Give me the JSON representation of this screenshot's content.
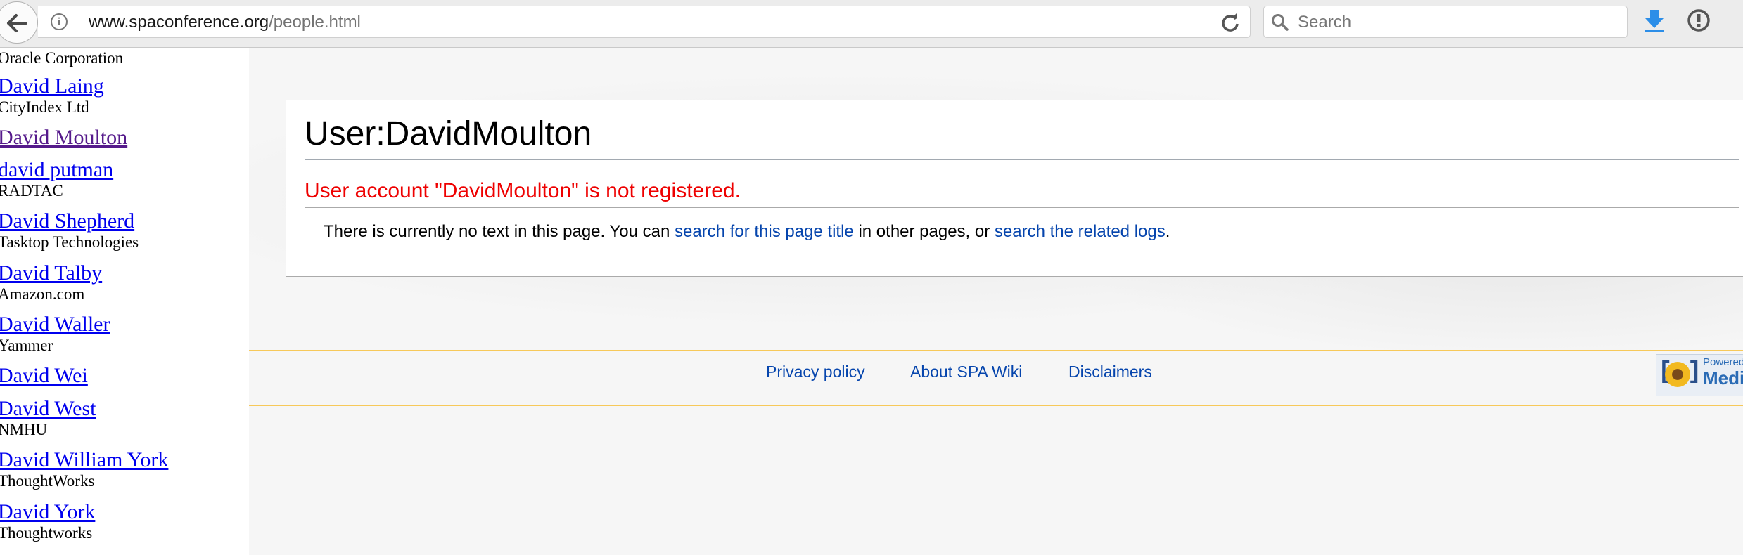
{
  "browser": {
    "url_host": "www.spaconference.org",
    "url_path": "/people.html",
    "search_placeholder": "Search"
  },
  "sidebar": {
    "people": [
      {
        "name": "",
        "org": "Oracle Corporation"
      },
      {
        "name": "David Laing",
        "org": "CityIndex Ltd"
      },
      {
        "name": "David Moulton",
        "org": ""
      },
      {
        "name": "david putman",
        "org": "RADTAC"
      },
      {
        "name": "David Shepherd",
        "org": "Tasktop Technologies"
      },
      {
        "name": "David Talby",
        "org": "Amazon.com"
      },
      {
        "name": "David Waller",
        "org": "Yammer"
      },
      {
        "name": "David Wei",
        "org": ""
      },
      {
        "name": "David West",
        "org": "NMHU"
      },
      {
        "name": "David William York",
        "org": "ThoughtWorks"
      },
      {
        "name": "David York",
        "org": "Thoughtworks"
      }
    ]
  },
  "page": {
    "title": "User:DavidMoulton",
    "error": "User account \"DavidMoulton\" is not registered.",
    "notice_prefix": "There is currently no text in this page. You can ",
    "notice_link1": "search for this page title",
    "notice_middle": " in other pages, or ",
    "notice_link2": "search the related logs",
    "notice_suffix": "."
  },
  "footer": {
    "links": [
      "Privacy policy",
      "About SPA Wiki",
      "Disclaimers"
    ],
    "badge_small": "Powered by",
    "badge_big": "MediaWiki"
  },
  "colors": {
    "link": "#0645ad",
    "error": "#ee0000",
    "footer_rule": "#f7c95a",
    "visited": "#551a8b"
  }
}
